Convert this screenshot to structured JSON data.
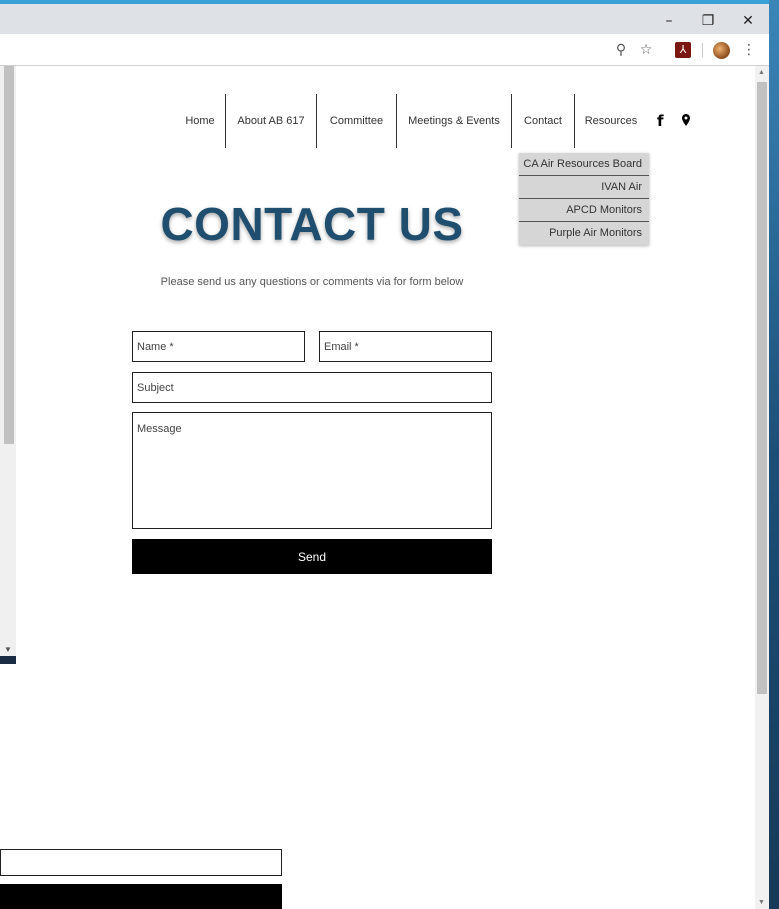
{
  "window": {
    "minimize_icon": "minimize-icon",
    "restore_icon": "restore-icon",
    "close_icon": "close-icon"
  },
  "toolbar": {
    "icons": [
      "zoom-icon",
      "star-icon",
      "pdf-icon",
      "profile-avatar",
      "menu-icon"
    ]
  },
  "nav": {
    "items": [
      {
        "label": "Home"
      },
      {
        "label": "About AB 617"
      },
      {
        "label": "Committee"
      },
      {
        "label": "Meetings & Events"
      },
      {
        "label": "Contact"
      },
      {
        "label": "Resources"
      }
    ],
    "social": [
      "facebook-icon",
      "location-pin-icon"
    ]
  },
  "dropdown": {
    "items": [
      {
        "label": "CA Air Resources Board"
      },
      {
        "label": "IVAN Air"
      },
      {
        "label": "APCD Monitors"
      },
      {
        "label": "Purple Air Monitors"
      }
    ]
  },
  "page": {
    "title": "CONTACT US",
    "subtitle": "Please send us any questions or comments via for form below"
  },
  "form": {
    "name_placeholder": "Name *",
    "email_placeholder": "Email *",
    "subject_placeholder": "Subject",
    "message_placeholder": "Message",
    "send_label": "Send"
  },
  "colors": {
    "title": "#1f4e6e",
    "dropdown_bg": "#d6d6d6",
    "button_bg": "#000000",
    "chrome_bg": "#dee1e6"
  }
}
